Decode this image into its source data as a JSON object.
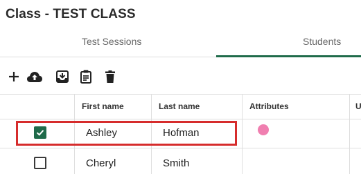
{
  "page": {
    "title": "Class - TEST CLASS"
  },
  "tabs": [
    {
      "label": "Test Sessions",
      "active": false
    },
    {
      "label": "Students",
      "active": true
    }
  ],
  "toolbar": {
    "icons": [
      "add-icon",
      "cloud-upload-icon",
      "download-icon",
      "clipboard-icon",
      "trash-icon"
    ]
  },
  "table": {
    "columns": [
      "First name",
      "Last name",
      "Attributes",
      "U"
    ],
    "rows": [
      {
        "checked": true,
        "first_name": "Ashley",
        "last_name": "Hofman",
        "attribute_color": "#f07fb0"
      },
      {
        "checked": false,
        "first_name": "Cheryl",
        "last_name": "Smith",
        "attribute_color": ""
      }
    ]
  },
  "colors": {
    "accent": "#1f6b4a",
    "highlight": "#d62c2c",
    "attribute": "#f07fb0"
  }
}
